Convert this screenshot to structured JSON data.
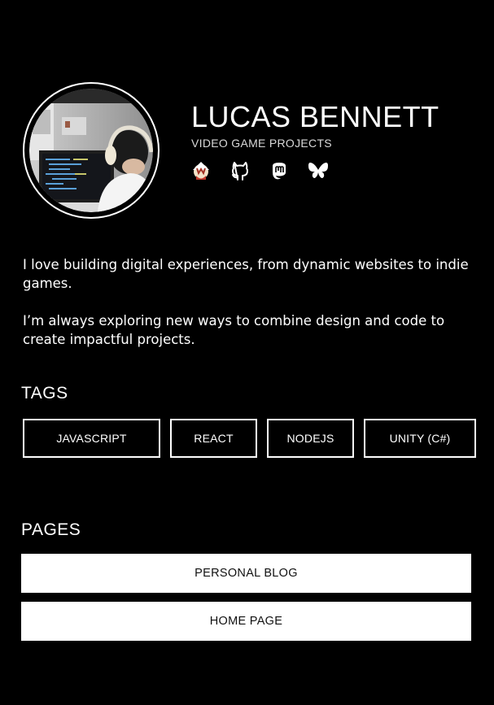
{
  "profile": {
    "name": "LUCAS BENNETT",
    "subtitle": "VIDEO GAME PROJECTS",
    "avatar_alt": "Developer at a desk with headphones looking at code on monitors",
    "socials": [
      {
        "name": "wizard-avatar-icon"
      },
      {
        "name": "github-icon"
      },
      {
        "name": "mastodon-icon"
      },
      {
        "name": "bluesky-icon"
      }
    ]
  },
  "bio": {
    "paragraph_1": "I love building digital experiences, from dynamic websites to indie games.",
    "paragraph_2": "I’m always exploring new ways to combine design and code to create impactful projects."
  },
  "tags": {
    "title": "TAGS",
    "items": [
      "JAVASCRIPT",
      "REACT",
      "NODEJS",
      "UNITY (C#)"
    ]
  },
  "pages": {
    "title": "PAGES",
    "items": [
      "PERSONAL BLOG",
      "HOME PAGE"
    ]
  },
  "colors": {
    "background": "#000000",
    "foreground": "#ffffff",
    "button_text": "#111111"
  }
}
